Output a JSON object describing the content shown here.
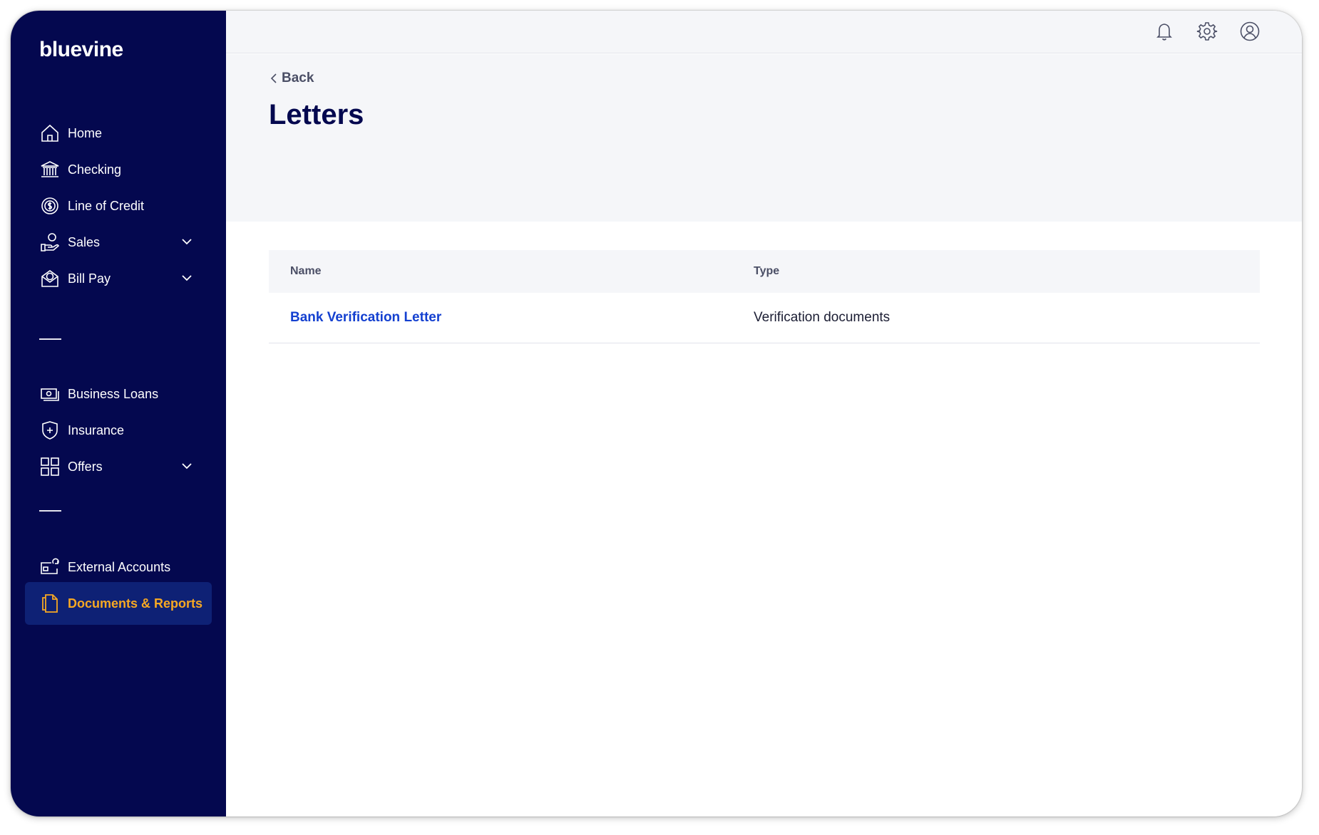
{
  "logo": "bluevine",
  "sidebar": {
    "items": [
      {
        "label": "Home"
      },
      {
        "label": "Checking"
      },
      {
        "label": "Line of Credit"
      },
      {
        "label": "Sales"
      },
      {
        "label": "Bill Pay"
      },
      {
        "label": "Business Loans"
      },
      {
        "label": "Insurance"
      },
      {
        "label": "Offers"
      },
      {
        "label": "External Accounts"
      },
      {
        "label": "Documents & Reports"
      }
    ],
    "active_item": "Documents & Reports"
  },
  "header": {
    "back_label": "Back",
    "title": "Letters"
  },
  "table": {
    "columns": [
      "Name",
      "Type"
    ],
    "rows": [
      {
        "name": "Bank Verification Letter",
        "type": "Verification documents"
      }
    ]
  },
  "colors": {
    "sidebar_bg": "#04084f",
    "active_bg": "#0e2175",
    "active_text": "#f7a823",
    "link": "#1440d0",
    "header_bg": "#f5f6f9"
  }
}
